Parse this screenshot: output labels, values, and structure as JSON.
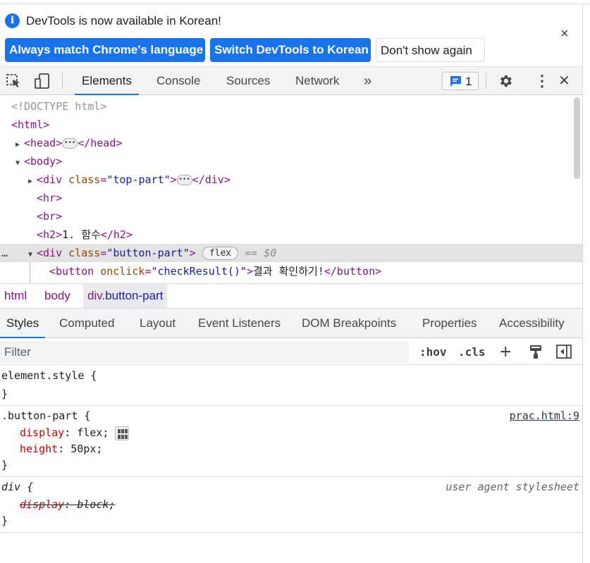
{
  "infobar": {
    "message": "DevTools is now available in Korean!",
    "btn_match": "Always match Chrome's language",
    "btn_switch": "Switch DevTools to Korean",
    "btn_dont_show": "Don't show again",
    "close": "×",
    "info_glyph": "i"
  },
  "toolbar": {
    "tabs": [
      "Elements",
      "Console",
      "Sources",
      "Network"
    ],
    "more": "»",
    "issues_count": "1",
    "close": "✕",
    "menu": "⋮"
  },
  "dom": {
    "doctype": "<!DOCTYPE html>",
    "html_open": "<html>",
    "head_open": "<head>",
    "head_close": "</head>",
    "body_open": "<body>",
    "div_open": "<div",
    "attr_class": "class",
    "top_part_val": "\"top-part\"",
    "div_close": "</div>",
    "hr": "<hr>",
    "br": "<br>",
    "h2_open": "<h2>",
    "h2_text": "1. 함수",
    "h2_close": "</h2>",
    "button_part_val": "\"button-part\"",
    "gt": ">",
    "eq": "=",
    "flex_badge": "flex",
    "eq_dollar": "== $0",
    "button_open": "<button",
    "attr_onclick": "onclick",
    "onclick_val": "\"checkResult()\"",
    "button_text": "결과 확인하기!",
    "button_close": "</button>",
    "row_ellipsis": "…"
  },
  "breadcrumb": {
    "items": [
      "html",
      "body"
    ],
    "active_tag": "div",
    "active_class": ".button-part"
  },
  "sidebar_tabs": [
    "Styles",
    "Computed",
    "Layout",
    "Event Listeners",
    "DOM Breakpoints",
    "Properties",
    "Accessibility"
  ],
  "filter": {
    "placeholder": "Filter",
    "hov": ":hov",
    "cls": ".cls",
    "add": "+"
  },
  "styles": {
    "element_style": "element.style {",
    "close_brace": "}",
    "rule1_selector": ".button-part {",
    "rule1_source": "prac.html:9",
    "rule1_prop1": "display",
    "rule1_val1": "flex",
    "rule1_prop2": "height",
    "rule1_val2": "50px",
    "rule2_selector": "div {",
    "rule2_source": "user agent stylesheet",
    "rule2_prop": "display",
    "rule2_val": "block",
    "colon": ":",
    "semicolon": ";"
  },
  "colors": {
    "accent": "#1a73e8",
    "tag": "#881280",
    "attribute": "#994500",
    "attribute_value": "#1a1aa6",
    "property": "#c80000"
  }
}
